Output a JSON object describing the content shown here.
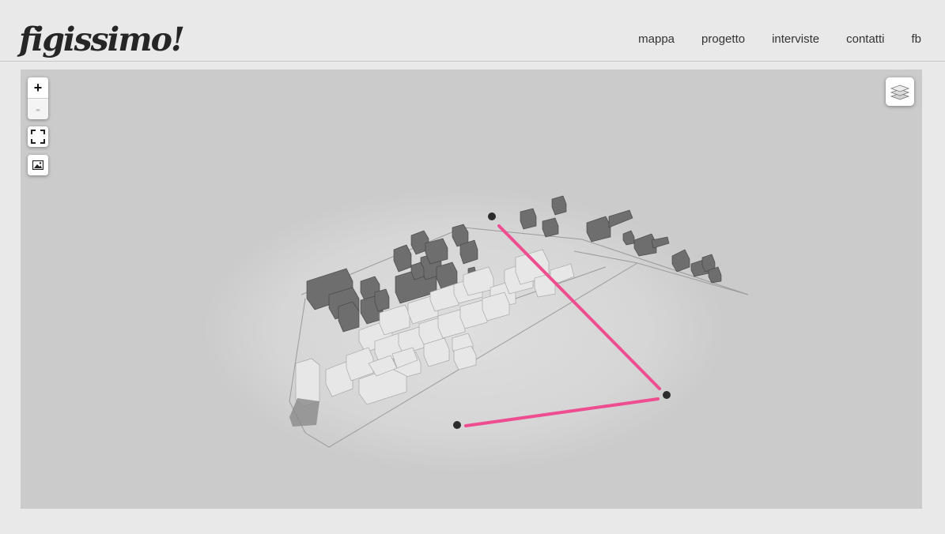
{
  "header": {
    "logo": "figissimo!",
    "nav": [
      "mappa",
      "progetto",
      "interviste",
      "contatti",
      "fb"
    ]
  },
  "map": {
    "controls": {
      "zoom_in": "+",
      "zoom_out": "-"
    },
    "route_color": "#ee4d8f",
    "building_dark": "#6a6a6a",
    "building_light": "#e6e6e6"
  }
}
